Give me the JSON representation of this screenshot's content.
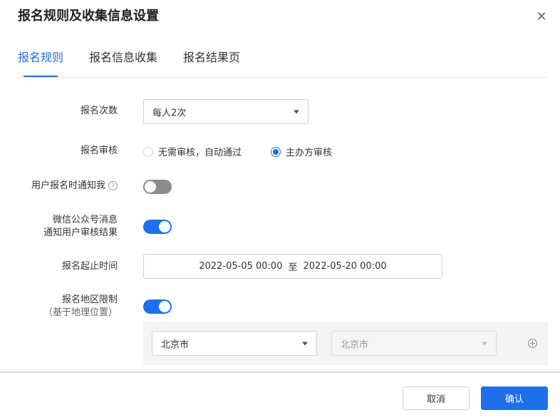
{
  "dialog": {
    "title": "报名规则及收集信息设置",
    "close_icon": "close-icon"
  },
  "tabs": [
    {
      "label": "报名规则",
      "active": true
    },
    {
      "label": "报名信息收集",
      "active": false
    },
    {
      "label": "报名结果页",
      "active": false
    }
  ],
  "form": {
    "signup_count": {
      "label": "报名次数",
      "value": "每人2次"
    },
    "review": {
      "label": "报名审核",
      "options": [
        {
          "label": "无需审核，自动通过",
          "selected": false
        },
        {
          "label": "主办方审核",
          "selected": true
        }
      ]
    },
    "notify_me": {
      "label": "用户报名时通知我",
      "help_icon": "question-circle-icon",
      "enabled": false
    },
    "wechat_notify": {
      "label_line1": "微信公众号消息",
      "label_line2": "通知用户审核结果",
      "enabled": true
    },
    "time_range": {
      "label": "报名起止时间",
      "start": "2022-05-05 00:00",
      "separator": "至",
      "end": "2022-05-20 00:00"
    },
    "region_limit": {
      "label_line1": "报名地区限制",
      "label_line2": "（基于地理位置）",
      "enabled": true,
      "province": "北京市",
      "city": "北京市",
      "add_icon": "plus-circle-icon"
    }
  },
  "footer": {
    "cancel_label": "取消",
    "confirm_label": "确认"
  },
  "colors": {
    "accent": "#1f6feb",
    "toggle_off": "#8c8c8c",
    "region_bg": "#f4f4f4"
  }
}
